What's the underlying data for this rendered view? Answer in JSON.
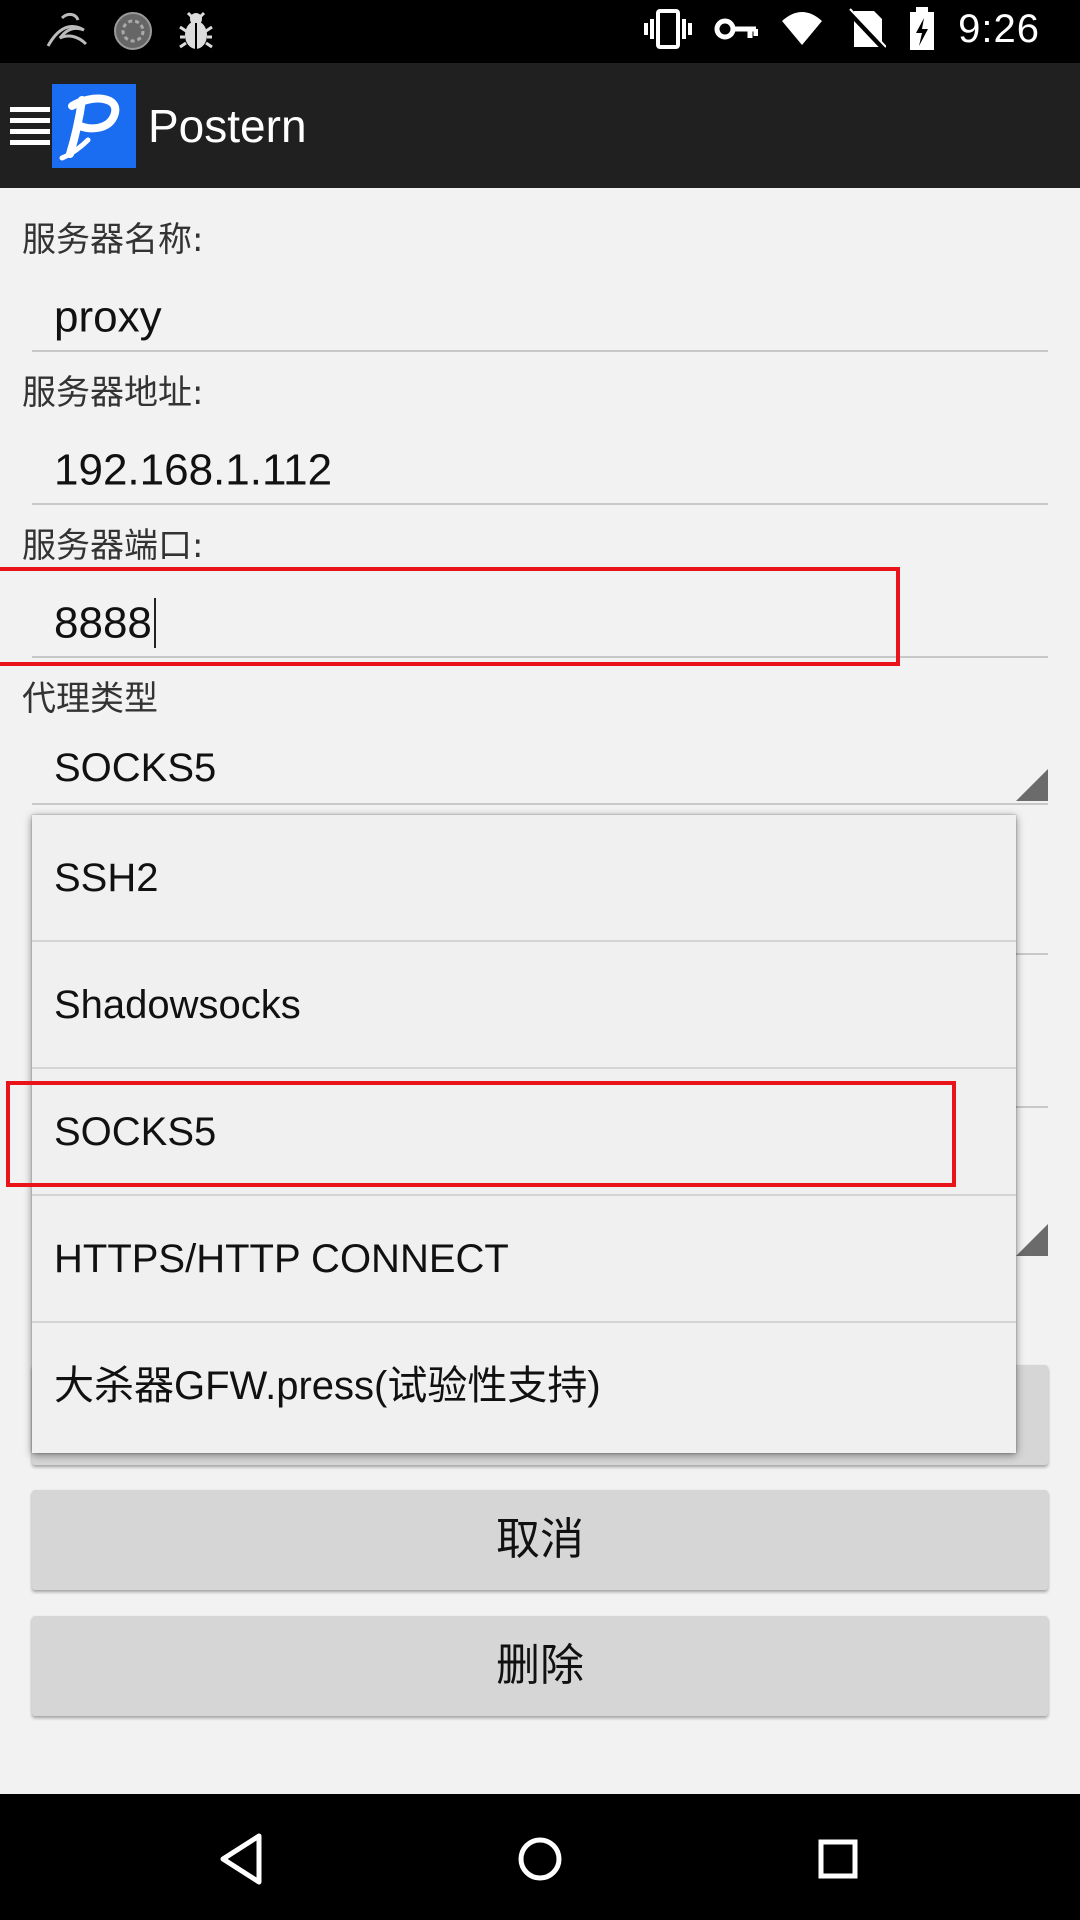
{
  "status_bar": {
    "time": "9:26",
    "icons_left": [
      "kali-dragon-icon",
      "sync-circle-icon",
      "bug-icon"
    ],
    "icons_right": [
      "vibrate-icon",
      "vpn-key-icon",
      "wifi-icon",
      "no-sim-icon",
      "battery-charging-icon"
    ]
  },
  "app_bar": {
    "title": "Postern",
    "menu_icon": "hamburger-menu-icon",
    "logo_icon": "postern-logo-icon"
  },
  "form": {
    "server_name": {
      "label": "服务器名称:",
      "value": "proxy"
    },
    "server_address": {
      "label": "服务器地址:",
      "value": "192.168.1.112"
    },
    "server_port": {
      "label": "服务器端口:",
      "value": "8888"
    },
    "proxy_type": {
      "label": "代理类型",
      "value": "SOCKS5"
    }
  },
  "dropdown": {
    "options": [
      "SSH2",
      "Shadowsocks",
      "SOCKS5",
      "HTTPS/HTTP CONNECT",
      "大杀器GFW.press(试验性支持)"
    ],
    "highlighted": "SOCKS5"
  },
  "buttons": {
    "cancel": "取消",
    "delete": "删除"
  },
  "nav_bar": {
    "back": "back-icon",
    "home": "home-icon",
    "recents": "recents-icon"
  },
  "colors": {
    "annotation": "#e8141a",
    "app_bar": "#202020",
    "logo": "#1a6df0"
  }
}
